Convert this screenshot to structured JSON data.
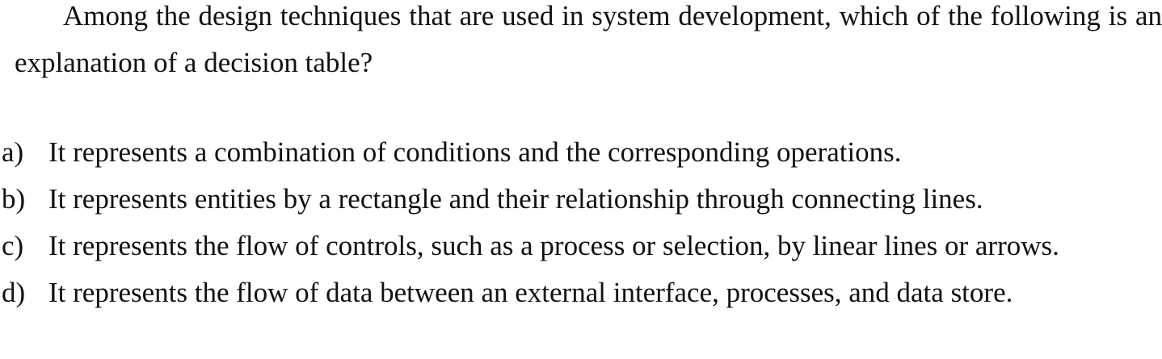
{
  "question": {
    "text": "Among the design techniques that are used in system development, which of the following is an explanation of a decision table?"
  },
  "options": [
    {
      "letter": "a)",
      "text": "It represents a combination of conditions and the corresponding operations."
    },
    {
      "letter": "b)",
      "text": "It represents entities by a rectangle and their relationship through connecting lines."
    },
    {
      "letter": "c)",
      "text": "It represents the flow of controls, such as a process or selection, by linear lines or arrows."
    },
    {
      "letter": "d)",
      "text": "It represents the flow of data between an external interface, processes, and data store."
    }
  ]
}
